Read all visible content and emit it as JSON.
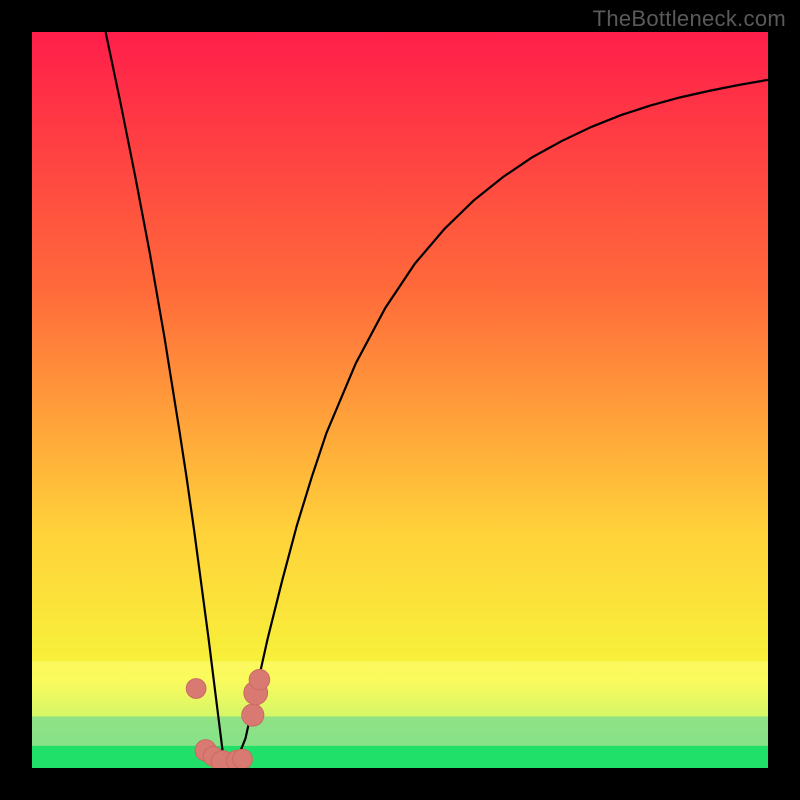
{
  "watermark": "TheBottleneck.com",
  "colors": {
    "frame": "#000000",
    "watermark": "#5a5a5a",
    "curve": "#000000",
    "marker_fill": "#d97a72",
    "marker_stroke": "#c96a62",
    "green_band": "#21e06a",
    "green_soft": "#8de08f",
    "yellow_band": "#ffff7a",
    "gradient_top": "#ff1e4a",
    "gradient_mid1": "#ff6a3a",
    "gradient_mid2": "#ffd23a",
    "gradient_bottom": "#2fe070"
  },
  "chart_data": {
    "type": "line",
    "title": "",
    "xlabel": "",
    "ylabel": "",
    "xlim": [
      0,
      100
    ],
    "ylim": [
      0,
      100
    ],
    "x_min_of_curve": 26,
    "series": [
      {
        "name": "bottleneck-curve",
        "x": [
          10,
          12,
          14,
          16,
          18,
          20,
          21,
          22,
          23,
          24,
          25,
          26,
          27,
          28,
          29,
          30,
          31,
          32,
          34,
          36,
          38,
          40,
          44,
          48,
          52,
          56,
          60,
          64,
          68,
          72,
          76,
          80,
          84,
          88,
          92,
          96,
          100
        ],
        "y": [
          100,
          90.5,
          80.5,
          70,
          58.5,
          46,
          39.5,
          32.5,
          25,
          17.5,
          9.5,
          1.5,
          0.5,
          1.5,
          4,
          8.5,
          13,
          17.5,
          25.5,
          33,
          39.5,
          45.5,
          55,
          62.5,
          68.5,
          73.2,
          77.1,
          80.3,
          83,
          85.2,
          87.1,
          88.7,
          90,
          91.1,
          92,
          92.8,
          93.5
        ]
      }
    ],
    "markers": [
      {
        "x": 22.3,
        "y": 10.8,
        "r": 1.2
      },
      {
        "x": 23.6,
        "y": 2.4,
        "r": 1.4
      },
      {
        "x": 24.6,
        "y": 1.6,
        "r": 1.2
      },
      {
        "x": 25.9,
        "y": 0.8,
        "r": 1.6
      },
      {
        "x": 27.8,
        "y": 1.0,
        "r": 1.3
      },
      {
        "x": 28.6,
        "y": 1.2,
        "r": 1.2
      },
      {
        "x": 30.0,
        "y": 7.2,
        "r": 1.5
      },
      {
        "x": 30.4,
        "y": 10.2,
        "r": 1.7
      },
      {
        "x": 30.9,
        "y": 12.0,
        "r": 1.3
      }
    ],
    "bands": [
      {
        "name": "yellow-band",
        "y0": 14.5,
        "y1": 7.0,
        "fill": "yellow_band",
        "alpha": 0.55
      },
      {
        "name": "green-soft",
        "y0": 7.0,
        "y1": 3.0,
        "fill": "green_soft",
        "alpha": 0.85
      },
      {
        "name": "green-band",
        "y0": 3.0,
        "y1": 0.0,
        "fill": "green_band",
        "alpha": 1.0
      }
    ]
  }
}
